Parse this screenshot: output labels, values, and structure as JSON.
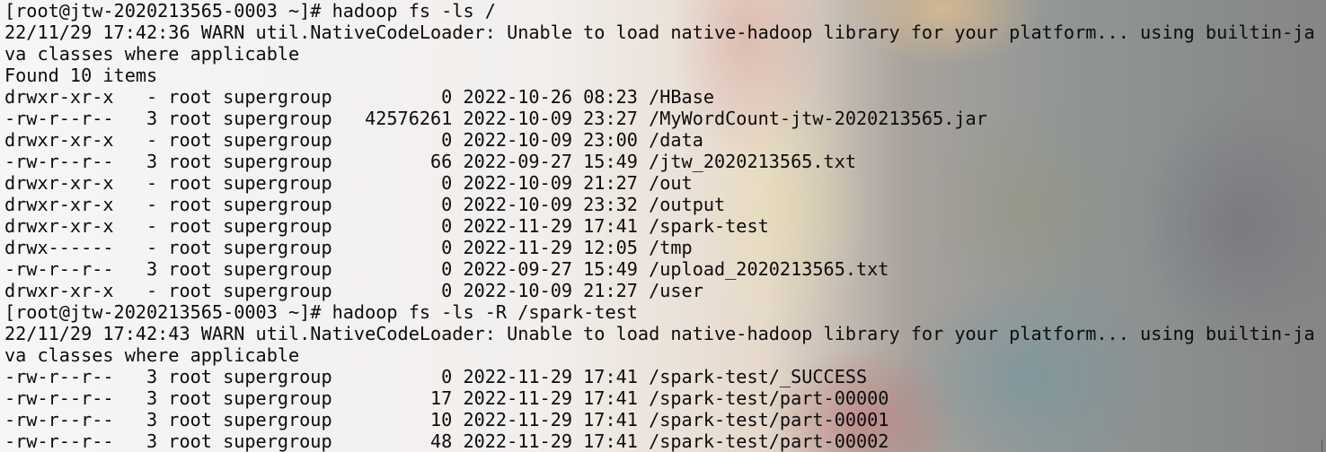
{
  "terminal": {
    "lines": [
      "[root@jtw-2020213565-0003 ~]# hadoop fs -ls /",
      "22/11/29 17:42:36 WARN util.NativeCodeLoader: Unable to load native-hadoop library for your platform... using builtin-ja",
      "va classes where applicable",
      "Found 10 items",
      "drwxr-xr-x   - root supergroup          0 2022-10-26 08:23 /HBase",
      "-rw-r--r--   3 root supergroup   42576261 2022-10-09 23:27 /MyWordCount-jtw-2020213565.jar",
      "drwxr-xr-x   - root supergroup          0 2022-10-09 23:00 /data",
      "-rw-r--r--   3 root supergroup         66 2022-09-27 15:49 /jtw_2020213565.txt",
      "drwxr-xr-x   - root supergroup          0 2022-10-09 21:27 /out",
      "drwxr-xr-x   - root supergroup          0 2022-10-09 23:32 /output",
      "drwxr-xr-x   - root supergroup          0 2022-11-29 17:41 /spark-test",
      "drwx------   - root supergroup          0 2022-11-29 12:05 /tmp",
      "-rw-r--r--   3 root supergroup          0 2022-09-27 15:49 /upload_2020213565.txt",
      "drwxr-xr-x   - root supergroup          0 2022-10-09 21:27 /user",
      "[root@jtw-2020213565-0003 ~]# hadoop fs -ls -R /spark-test",
      "22/11/29 17:42:43 WARN util.NativeCodeLoader: Unable to load native-hadoop library for your platform... using builtin-ja",
      "va classes where applicable",
      "-rw-r--r--   3 root supergroup          0 2022-11-29 17:41 /spark-test/_SUCCESS",
      "-rw-r--r--   3 root supergroup         17 2022-11-29 17:41 /spark-test/part-00000",
      "-rw-r--r--   3 root supergroup         10 2022-11-29 17:41 /spark-test/part-00001",
      "-rw-r--r--   3 root supergroup         48 2022-11-29 17:41 /spark-test/part-00002"
    ]
  }
}
